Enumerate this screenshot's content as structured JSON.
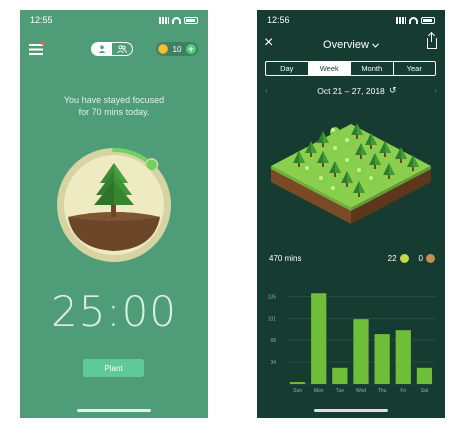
{
  "screen1": {
    "status_time": "12:55",
    "coins": "10",
    "coin_add": "+",
    "focus_message_line1": "You have stayed focused",
    "focus_message_line2": "for 70 mins today.",
    "timer": "25:00",
    "plant_button": "Plant",
    "progress": 0.12,
    "colors": {
      "background": "#4f9d78",
      "button": "#60c99a",
      "ring": "#d8d3a3"
    }
  },
  "screen2": {
    "status_time": "12:56",
    "title": "Overview",
    "close_icon": "×",
    "tabs": [
      {
        "label": "Day",
        "active": false
      },
      {
        "label": "Week",
        "active": true
      },
      {
        "label": "Month",
        "active": false
      },
      {
        "label": "Year",
        "active": false
      }
    ],
    "date_range": "Oct 21 – 27, 2018",
    "prev_arrow": "‹",
    "next_arrow": "›",
    "refresh_icon": "↺",
    "total_mins": "470 mins",
    "healthy_trees": "22",
    "dead_trees": "0",
    "colors": {
      "background": "#163b30",
      "bar": "#6fbe3a"
    }
  },
  "chart_data": {
    "type": "bar",
    "categories": [
      "Sun",
      "Mon",
      "Tue",
      "Wed",
      "Thu",
      "Fri",
      "Sat"
    ],
    "values": [
      3,
      140,
      25,
      100,
      77,
      83,
      25
    ],
    "yticks": [
      0,
      34,
      68,
      101,
      135
    ],
    "ylim": [
      0,
      145
    ],
    "grid": true
  }
}
